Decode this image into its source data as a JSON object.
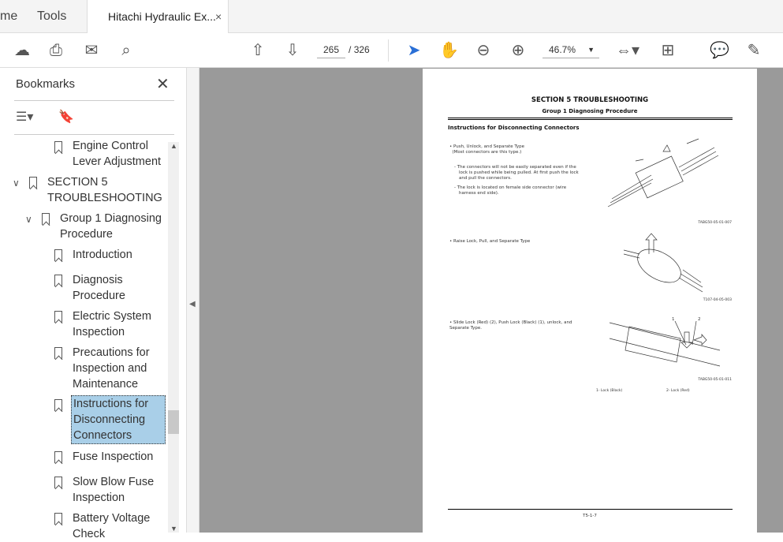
{
  "tabs": [
    {
      "label": "me"
    },
    {
      "label": "Tools"
    },
    {
      "label": "Hitachi Hydraulic Ex..."
    }
  ],
  "tab_close": "×",
  "toolbar": {
    "current_page": "265",
    "page_sep": "/",
    "total_pages": "326",
    "zoom": "46.7%"
  },
  "sidebar": {
    "title": "Bookmarks",
    "close": "✕",
    "items": [
      {
        "label": "Engine Control Lever Adjustment"
      },
      {
        "label": "SECTION 5 TROUBLESHOOTING"
      },
      {
        "label": "Group 1 Diagnosing Procedure"
      },
      {
        "label": "Introduction"
      },
      {
        "label": "Diagnosis Procedure"
      },
      {
        "label": "Electric System Inspection"
      },
      {
        "label": "Precautions for Inspection and Maintenance"
      },
      {
        "label": "Instructions for Disconnecting Connectors"
      },
      {
        "label": "Fuse Inspection"
      },
      {
        "label": "Slow Blow Fuse Inspection"
      },
      {
        "label": "Battery Voltage Check"
      }
    ]
  },
  "document": {
    "section": "SECTION 5 TROUBLESHOOTING",
    "group": "Group 1 Diagnosing Procedure",
    "heading": "Instructions for Disconnecting Connectors",
    "b1_title": "Push, Unlock, and Separate Type",
    "b1_sub": "(Most connectors are this type.)",
    "b1_n1": "The connectors will not be easily separated even if the lock is pushed while being pulled. At first push the lock and pull the connectors.",
    "b1_n2": "The lock is located on female side connector (wire harness end side).",
    "fig1": "TABG50-05-01-007",
    "b2_title": "Raise Lock, Pull, and Separate Type",
    "fig2": "T107-04-05-003",
    "b3_title": "Slide Lock (Red) (2), Push Lock (Black) (1), unlock, and Separate Type.",
    "fig3": "TABG50-05-01-011",
    "legend1": "1-    Lock (Black)",
    "legend2": "2-    Lock (Red)",
    "callout1": "1",
    "callout2": "2",
    "footer": "T5-1-7"
  }
}
